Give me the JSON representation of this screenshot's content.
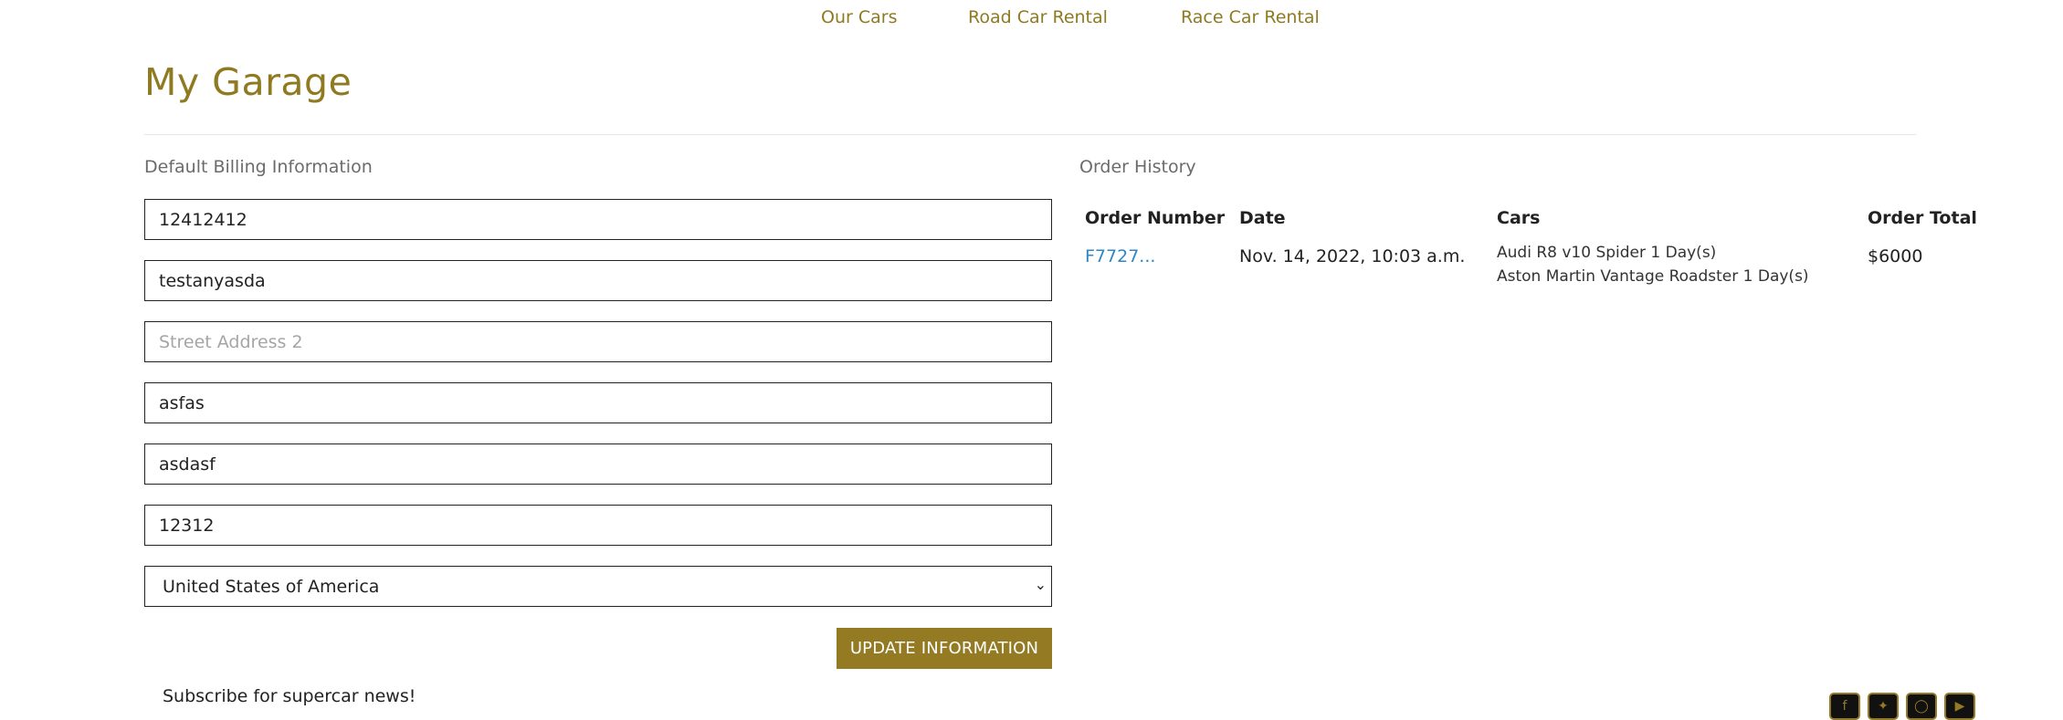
{
  "nav": {
    "items": [
      {
        "label": "Our Cars"
      },
      {
        "label": "Road Car Rental"
      },
      {
        "label": "Race Car Rental"
      }
    ]
  },
  "page": {
    "title": "My Garage"
  },
  "billing": {
    "heading": "Default Billing Information",
    "fields": [
      {
        "value": "12412412",
        "placeholder": ""
      },
      {
        "value": "testanyasda",
        "placeholder": ""
      },
      {
        "value": "",
        "placeholder": "Street Address 2"
      },
      {
        "value": "asfas",
        "placeholder": ""
      },
      {
        "value": "asdasf",
        "placeholder": ""
      },
      {
        "value": "12312",
        "placeholder": ""
      }
    ],
    "country": "United States of America",
    "update_label": "UPDATE INFORMATION",
    "accent_color": "#937a23"
  },
  "orders": {
    "heading": "Order History",
    "columns": [
      "Order Number",
      "Date",
      "Cars",
      "Order Total"
    ],
    "rows": [
      {
        "order_number": "F7727...",
        "date": "Nov. 14, 2022, 10:03 a.m.",
        "cars": [
          "Audi R8 v10 Spider 1 Day(s)",
          "Aston Martin Vantage Roadster 1 Day(s)"
        ],
        "total": "$6000"
      }
    ]
  },
  "footer": {
    "subscribe_text": "Subscribe for supercar news!",
    "social_icons": [
      "facebook-icon",
      "twitter-icon",
      "instagram-icon",
      "youtube-icon"
    ]
  }
}
